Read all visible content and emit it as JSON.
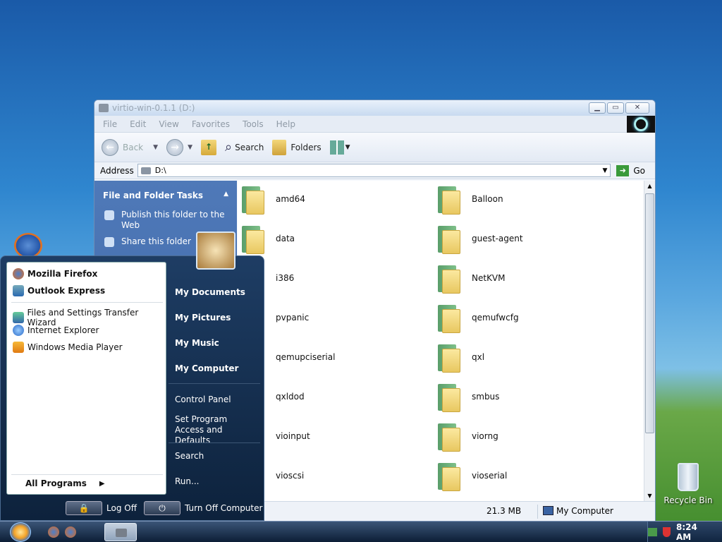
{
  "desktop": {
    "recycle_bin_label": "Recycle Bin"
  },
  "explorer": {
    "title": "virtio-win-0.1.1 (D:)",
    "menu": [
      "File",
      "Edit",
      "View",
      "Favorites",
      "Tools",
      "Help"
    ],
    "toolbar": {
      "back": "Back",
      "search": "Search",
      "folders": "Folders"
    },
    "address": {
      "label": "Address",
      "value": "D:\\",
      "go": "Go"
    },
    "taskpane": {
      "header": "File and Folder Tasks",
      "links": [
        "Publish this folder to the Web",
        "Share this folder"
      ]
    },
    "folders_left": [
      "amd64",
      "data",
      "i386",
      "pvpanic",
      "qemupciserial",
      "qxldod",
      "vioinput",
      "vioscsi"
    ],
    "folders_right": [
      "Balloon",
      "guest-agent",
      "NetKVM",
      "qemufwcfg",
      "qxl",
      "smbus",
      "viorng",
      "vioserial"
    ],
    "status": {
      "size": "21.3 MB",
      "location": "My Computer"
    }
  },
  "start_menu": {
    "pinned": [
      "Mozilla Firefox",
      "Outlook Express"
    ],
    "recent": [
      "Files and Settings Transfer Wizard",
      "Internet Explorer",
      "Windows Media Player"
    ],
    "all_programs": "All Programs",
    "places": [
      "My Documents",
      "My Pictures",
      "My Music",
      "My Computer"
    ],
    "settings": [
      "Control Panel",
      "Set Program Access and Defaults",
      "Search",
      "Run..."
    ],
    "log_off": "Log Off",
    "turn_off": "Turn Off Computer"
  },
  "taskbar": {
    "clock": "8:24 AM"
  }
}
